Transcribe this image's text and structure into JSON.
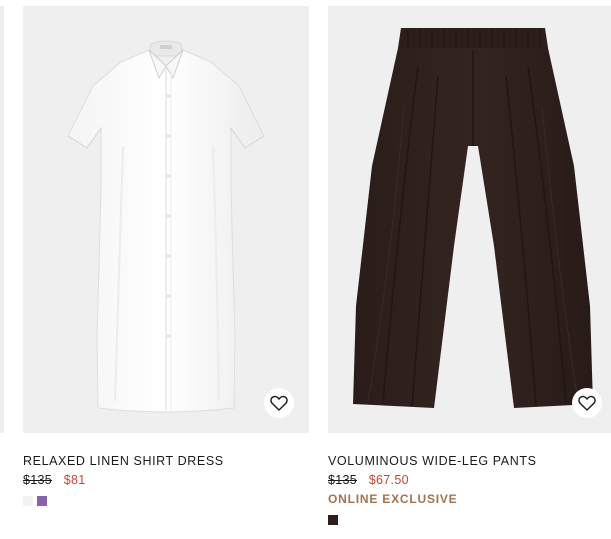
{
  "products": [
    {
      "name": "RELAXED LINEN SHIRT DRESS",
      "original_price": "$135",
      "sale_price": "$81",
      "badge": "",
      "image_subject": "white linen short-sleeve shirt dress",
      "wishlist_icon": "heart-outline-icon",
      "swatches": [
        {
          "name": "white",
          "color": "#f2f2f2"
        },
        {
          "name": "purple",
          "color": "#8a62ab"
        }
      ]
    },
    {
      "name": "VOLUMINOUS WIDE-LEG PANTS",
      "original_price": "$135",
      "sale_price": "$67.50",
      "badge": "ONLINE EXCLUSIVE",
      "image_subject": "dark brown wide-leg pants",
      "wishlist_icon": "heart-outline-icon",
      "swatches": [
        {
          "name": "dark-brown",
          "color": "#2e1f1b"
        }
      ]
    }
  ],
  "colors": {
    "sale": "#c8462f",
    "badge": "#a5744f",
    "image_background": "#efefef"
  }
}
